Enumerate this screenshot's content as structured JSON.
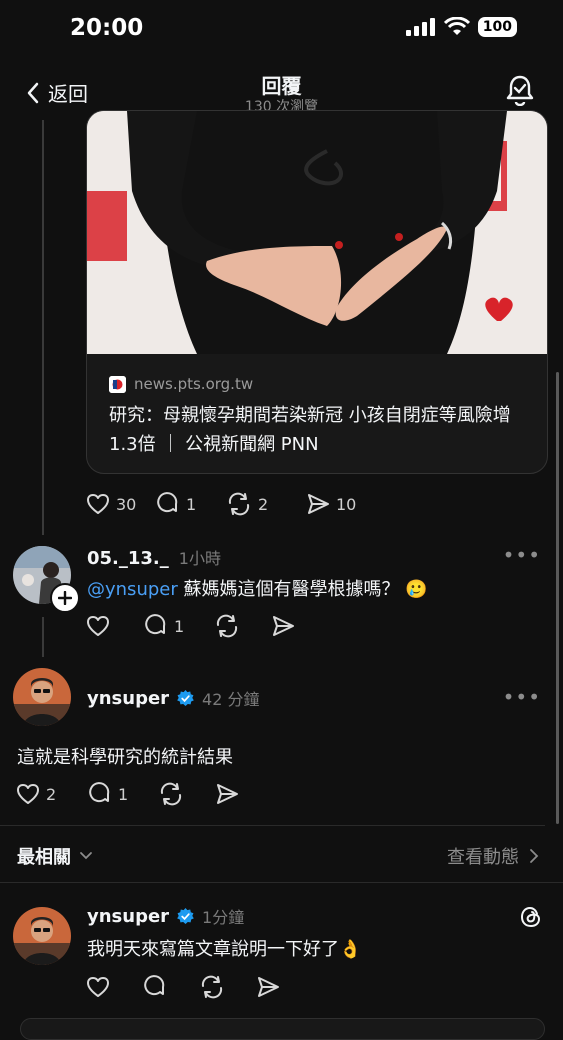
{
  "status": {
    "time": "20:00",
    "battery": "100"
  },
  "header": {
    "back_label": "返回",
    "title": "回覆",
    "views": "130 次瀏覽"
  },
  "link_card": {
    "domain": "news.pts.org.tw",
    "headline": "研究：母親懷孕期間若染新冠 小孩自閉症等風險增1.3倍 ｜ 公視新聞網 PNN"
  },
  "post_actions": {
    "likes": "30",
    "replies": "1",
    "reposts": "2",
    "shares": "10"
  },
  "reply1": {
    "username": "05._13._",
    "time": "1小時",
    "mention": "@ynsuper",
    "text": " 蘇媽媽這個有醫學根據嗎？ 🥲",
    "replies": "1"
  },
  "reply2": {
    "username": "ynsuper",
    "time": "42 分鐘",
    "text": "這就是科學研究的統計結果",
    "likes": "2",
    "replies": "1"
  },
  "sort": {
    "label": "最相關",
    "view_activity": "查看動態"
  },
  "reply3": {
    "username": "ynsuper",
    "time": "1分鐘",
    "text": "我明天來寫篇文章說明一下好了👌"
  },
  "colors": {
    "background": "#101010",
    "mention": "#4a9ff5",
    "verified": "#1d9bf0",
    "heart_red": "#d8232a"
  }
}
